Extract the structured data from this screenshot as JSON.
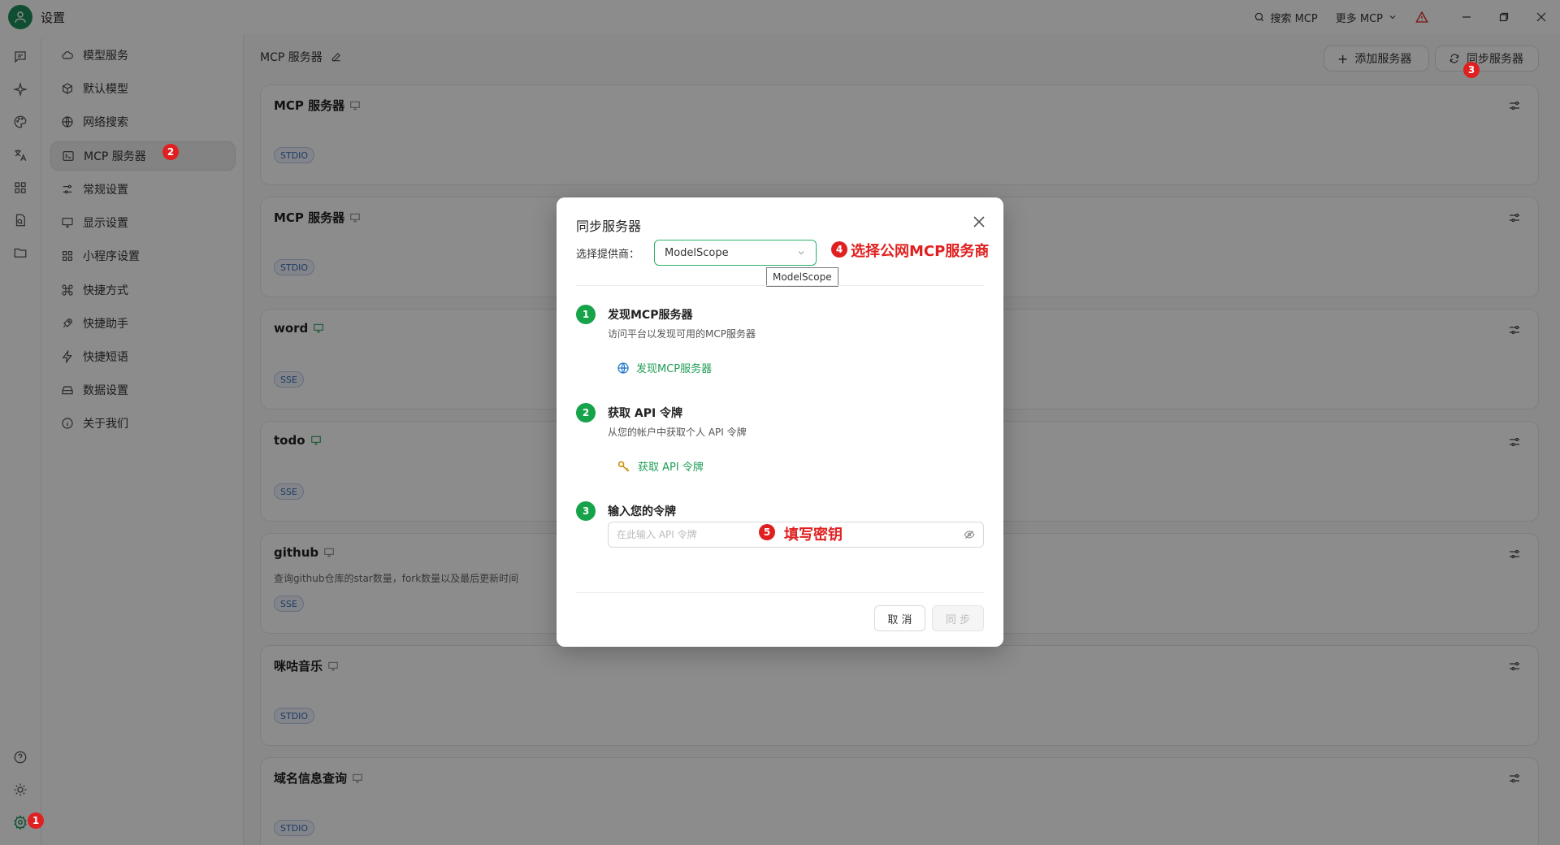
{
  "app": {
    "title": "设置"
  },
  "titlebar": {
    "search_label": "搜索 MCP",
    "more_label": "更多 MCP"
  },
  "nav": {
    "items": [
      {
        "label": "模型服务",
        "icon": "cloud-icon"
      },
      {
        "label": "默认模型",
        "icon": "cube-icon"
      },
      {
        "label": "网络搜索",
        "icon": "globe-icon"
      },
      {
        "label": "MCP 服务器",
        "icon": "terminal-icon"
      },
      {
        "label": "常规设置",
        "icon": "sliders-icon"
      },
      {
        "label": "显示设置",
        "icon": "monitor-icon"
      },
      {
        "label": "小程序设置",
        "icon": "grid-icon"
      },
      {
        "label": "快捷方式",
        "icon": "command-icon"
      },
      {
        "label": "快捷助手",
        "icon": "rocket-icon"
      },
      {
        "label": "快捷短语",
        "icon": "zap-icon"
      },
      {
        "label": "数据设置",
        "icon": "database-icon"
      },
      {
        "label": "关于我们",
        "icon": "info-icon"
      }
    ],
    "active_index": 3
  },
  "main": {
    "header_title": "MCP 服务器",
    "add_button": "添加服务器",
    "sync_button": "同步服务器",
    "cards": [
      {
        "title": "MCP 服务器",
        "desc": "",
        "badge": "STDIO"
      },
      {
        "title": "MCP 服务器",
        "desc": "",
        "badge": "STDIO"
      },
      {
        "title": "word",
        "desc": "",
        "badge": "SSE"
      },
      {
        "title": "todo",
        "desc": "",
        "badge": "SSE"
      },
      {
        "title": "github",
        "desc": "查询github仓库的star数量，fork数量以及最后更新时间",
        "badge": "SSE"
      },
      {
        "title": "咪咕音乐",
        "desc": "",
        "badge": "STDIO"
      },
      {
        "title": "域名信息查询",
        "desc": "",
        "badge": "STDIO"
      }
    ]
  },
  "modal": {
    "title": "同步服务器",
    "provider_label": "选择提供商：",
    "provider_value": "ModelScope",
    "tooltip": "ModelScope",
    "steps": [
      {
        "num": "1",
        "title": "发现MCP服务器",
        "desc": "访问平台以发现可用的MCP服务器",
        "link": "发现MCP服务器"
      },
      {
        "num": "2",
        "title": "获取 API 令牌",
        "desc": "从您的帐户中获取个人 API 令牌",
        "link": "获取 API 令牌"
      },
      {
        "num": "3",
        "title": "输入您的令牌",
        "desc": "",
        "link": ""
      }
    ],
    "token_placeholder": "在此输入 API 令牌",
    "cancel": "取 消",
    "sync": "同 步"
  },
  "annotations": {
    "n1": "1",
    "n2": "2",
    "n3": "3",
    "n4": "4",
    "n5": "5",
    "text4": "选择公网MCP服务商",
    "text5": "填写密钥"
  },
  "colors": {
    "accent": "#16a34a",
    "annotation": "#e02020",
    "badge_text": "#3a6cb8"
  }
}
